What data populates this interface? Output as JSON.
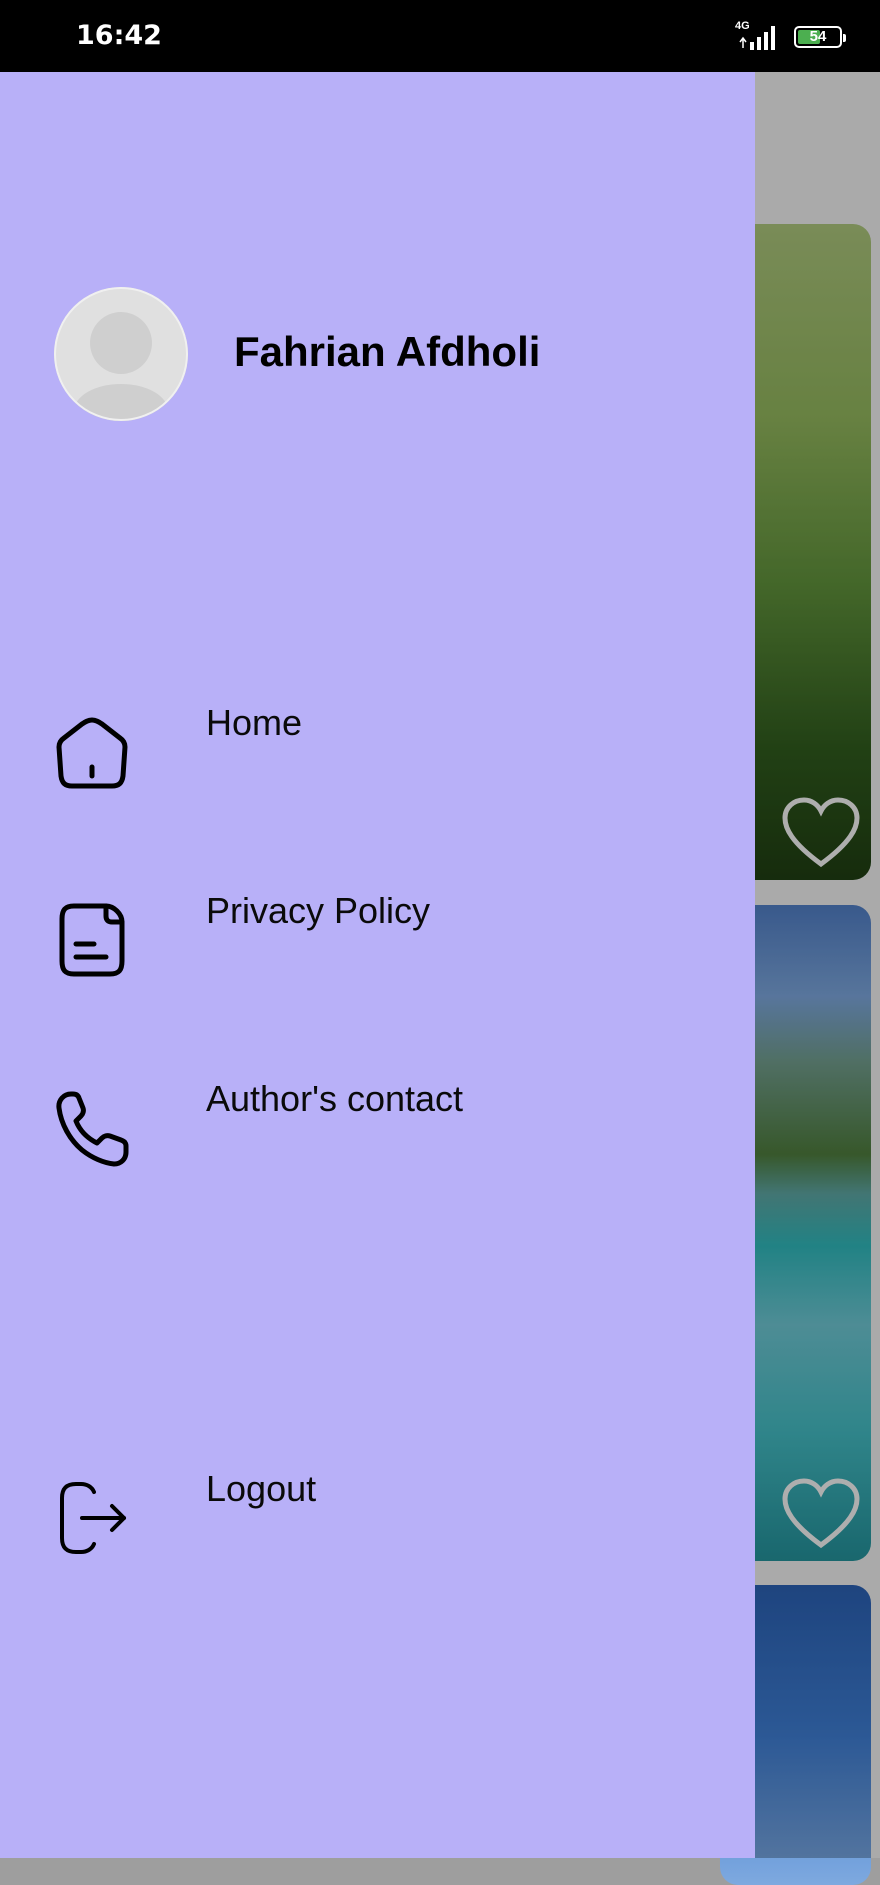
{
  "status_bar": {
    "time": "16:42",
    "network": "4G",
    "battery": "54",
    "battery_level": 0.54
  },
  "drawer": {
    "user_name": "Fahrian Afdholi",
    "menu": [
      {
        "label": "Home",
        "icon": "home-icon"
      },
      {
        "label": "Privacy Policy",
        "icon": "document-icon"
      },
      {
        "label": "Author's contact",
        "icon": "phone-icon"
      }
    ],
    "logout": {
      "label": "Logout",
      "icon": "logout-icon"
    }
  },
  "colors": {
    "drawer_bg": "#b8b0f8",
    "status_bar_bg": "#000000",
    "text": "#000000"
  }
}
